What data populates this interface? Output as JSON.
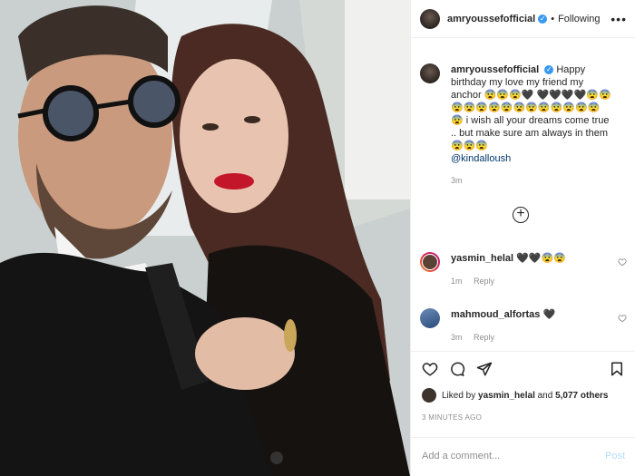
{
  "header": {
    "username": "amryoussefofficial",
    "separator": "•",
    "follow_status": "Following",
    "more": "•••"
  },
  "caption": {
    "username": "amryoussefofficial",
    "text": "Happy birthday my love my friend my anchor 😨😨😨🖤 🖤🖤🖤🖤😨😨😨😨😨😨😨😨😨😨😨😨😨😨😨 i wish all your dreams come true .. but make sure am always in them 😨😨😨",
    "mention": "@kindalloush",
    "time": "3m"
  },
  "load_more": "+",
  "comments": [
    {
      "username": "yasmin_helal",
      "text": "🖤🖤😨😨",
      "time": "1m",
      "reply": "Reply"
    },
    {
      "username": "mahmoud_alfortas",
      "text": "🖤",
      "time": "3m",
      "reply": "Reply"
    }
  ],
  "likes": {
    "prefix": "Liked by ",
    "user": "yasmin_helal",
    "middle": " and ",
    "others": "5,077 others"
  },
  "posted_ago": "3 MINUTES AGO",
  "add_comment": {
    "placeholder": "Add a comment...",
    "post_label": "Post"
  }
}
